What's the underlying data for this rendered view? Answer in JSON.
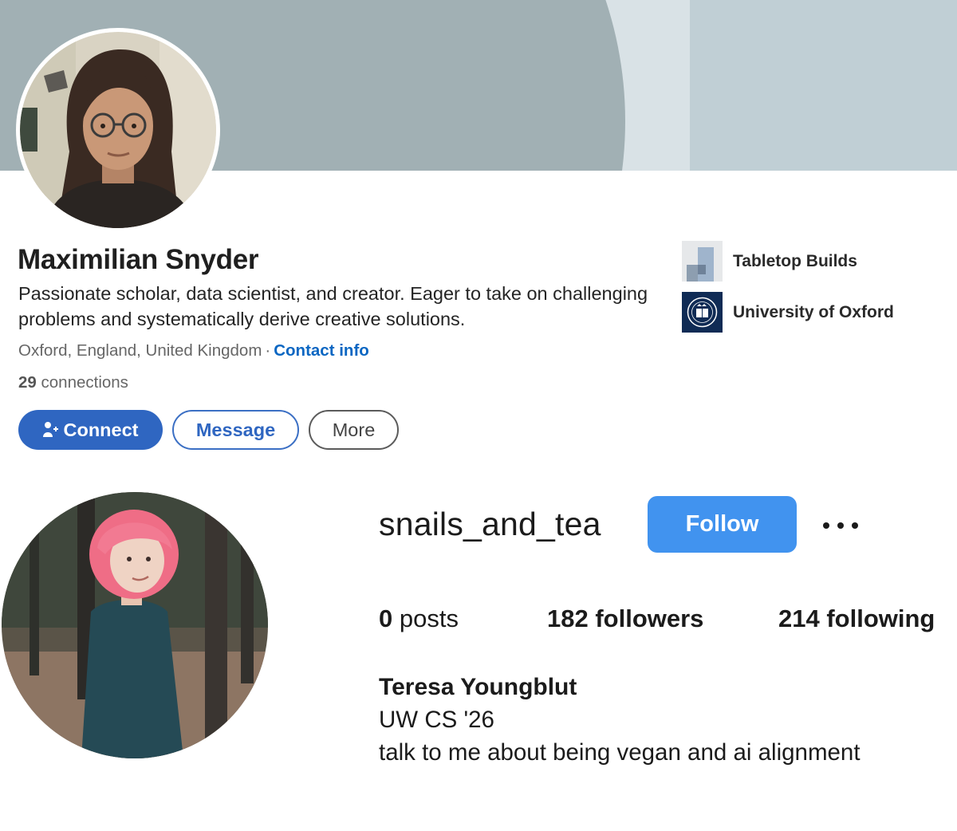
{
  "linkedin": {
    "name": "Maximilian Snyder",
    "headline": "Passionate scholar, data scientist, and creator. Eager to take on challenging problems and systematically derive creative solutions.",
    "location": "Oxford, England, United Kingdom",
    "separator": "·",
    "contact_info": "Contact info",
    "connections_count": "29",
    "connections_label": "connections",
    "buttons": {
      "connect": "Connect",
      "message": "Message",
      "more": "More"
    },
    "organizations": [
      {
        "name": "Tabletop Builds",
        "icon": "tabletop-builds-logo"
      },
      {
        "name": "University of Oxford",
        "icon": "university-of-oxford-crest"
      }
    ],
    "colors": {
      "brand_blue": "#0a66c2",
      "banner_dark": "#a1b0b4",
      "banner_light": "#c0cfd5"
    }
  },
  "instagram": {
    "username": "snails_and_tea",
    "follow_label": "Follow",
    "more_icon": "ellipsis-icon",
    "stats": {
      "posts_count": "0",
      "posts_label": "posts",
      "followers": "182 followers",
      "following": "214 following"
    },
    "full_name": "Teresa Youngblut",
    "bio_lines": [
      "UW CS '26",
      "talk to me about being vegan and ai alignment"
    ],
    "colors": {
      "follow_button": "#4193ef"
    }
  }
}
